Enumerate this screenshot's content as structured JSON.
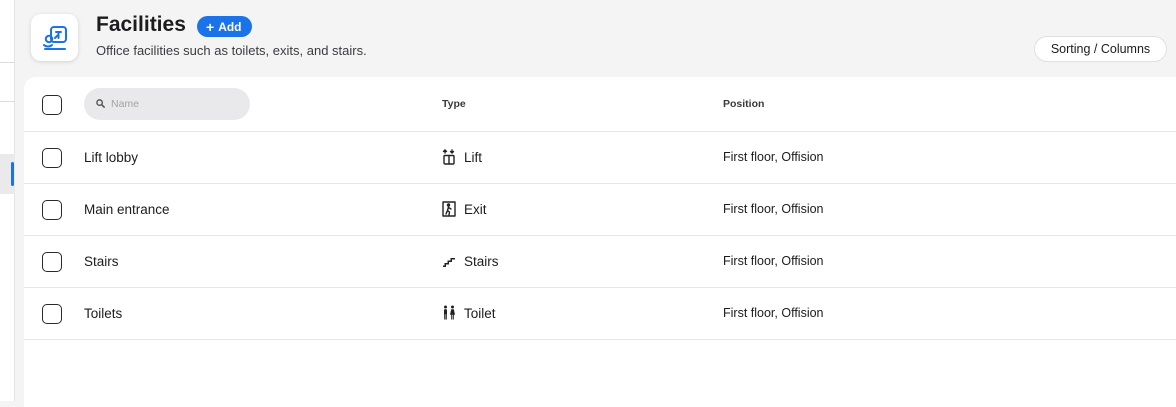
{
  "header": {
    "title": "Facilities",
    "add_label": "Add",
    "subtitle": "Office facilities such as toilets, exits, and stairs.",
    "sort_columns_label": "Sorting / Columns",
    "app_icon": "facilities-map-icon"
  },
  "table": {
    "search_placeholder": "Name",
    "columns": {
      "type": "Type",
      "position": "Position"
    },
    "rows": [
      {
        "name": "Lift lobby",
        "type": "Lift",
        "type_icon": "lift-icon",
        "position": "First floor, Offision"
      },
      {
        "name": "Main entrance",
        "type": "Exit",
        "type_icon": "exit-icon",
        "position": "First floor, Offision"
      },
      {
        "name": "Stairs",
        "type": "Stairs",
        "type_icon": "stairs-icon",
        "position": "First floor, Offision"
      },
      {
        "name": "Toilets",
        "type": "Toilet",
        "type_icon": "toilet-icon",
        "position": "First floor, Offision"
      }
    ]
  },
  "colors": {
    "accent": "#1a73e8",
    "background": "#f4f4f5"
  }
}
